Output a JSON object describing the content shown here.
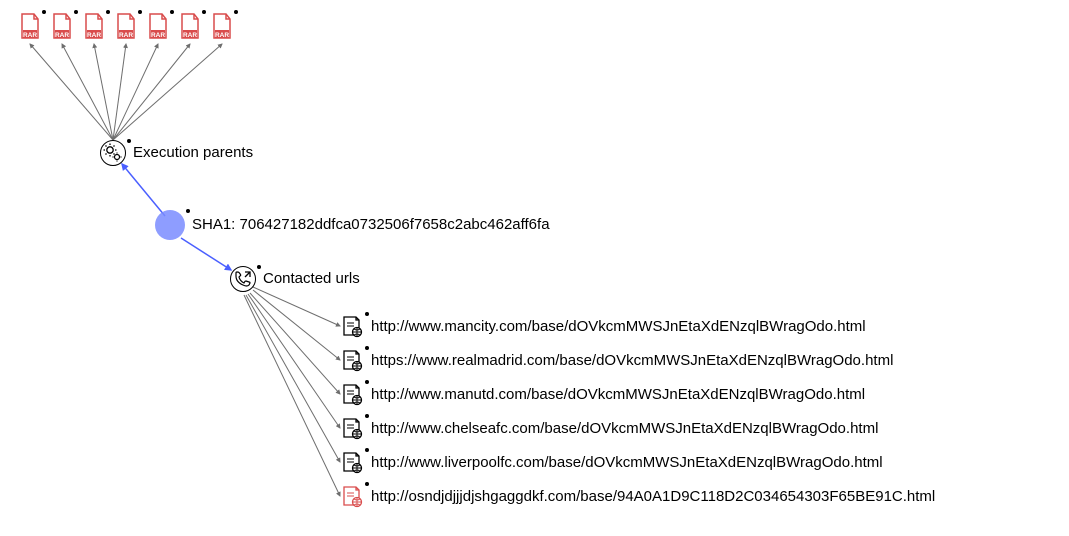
{
  "nodes": {
    "sha1": {
      "label": "SHA1: 706427182ddfca0732506f7658c2abc462aff6fa"
    },
    "execution_parents": {
      "label": "Execution parents"
    },
    "contacted_urls": {
      "label": "Contacted urls"
    }
  },
  "rar_files": [
    {},
    {},
    {},
    {},
    {},
    {},
    {}
  ],
  "urls": [
    {
      "text": "http://www.mancity.com/base/dOVkcmMWSJnEtaXdENzqlBWragOdo.html",
      "malicious": false
    },
    {
      "text": "https://www.realmadrid.com/base/dOVkcmMWSJnEtaXdENzqlBWragOdo.html",
      "malicious": false
    },
    {
      "text": "http://www.manutd.com/base/dOVkcmMWSJnEtaXdENzqlBWragOdo.html",
      "malicious": false
    },
    {
      "text": "http://www.chelseafc.com/base/dOVkcmMWSJnEtaXdENzqlBWragOdo.html",
      "malicious": false
    },
    {
      "text": "http://www.liverpoolfc.com/base/dOVkcmMWSJnEtaXdENzqlBWragOdo.html",
      "malicious": false
    },
    {
      "text": "http://osndjdjjjdjshgaggdkf.com/base/94A0A1D9C118D2C034654303F65BE91C.html",
      "malicious": true
    }
  ],
  "colors": {
    "selected_node": "#7a8cff",
    "edge_normal": "#6e6e6e",
    "edge_highlight": "#4a5fff",
    "rar_red": "#d94c4c",
    "malicious_red": "#d94c4c"
  }
}
